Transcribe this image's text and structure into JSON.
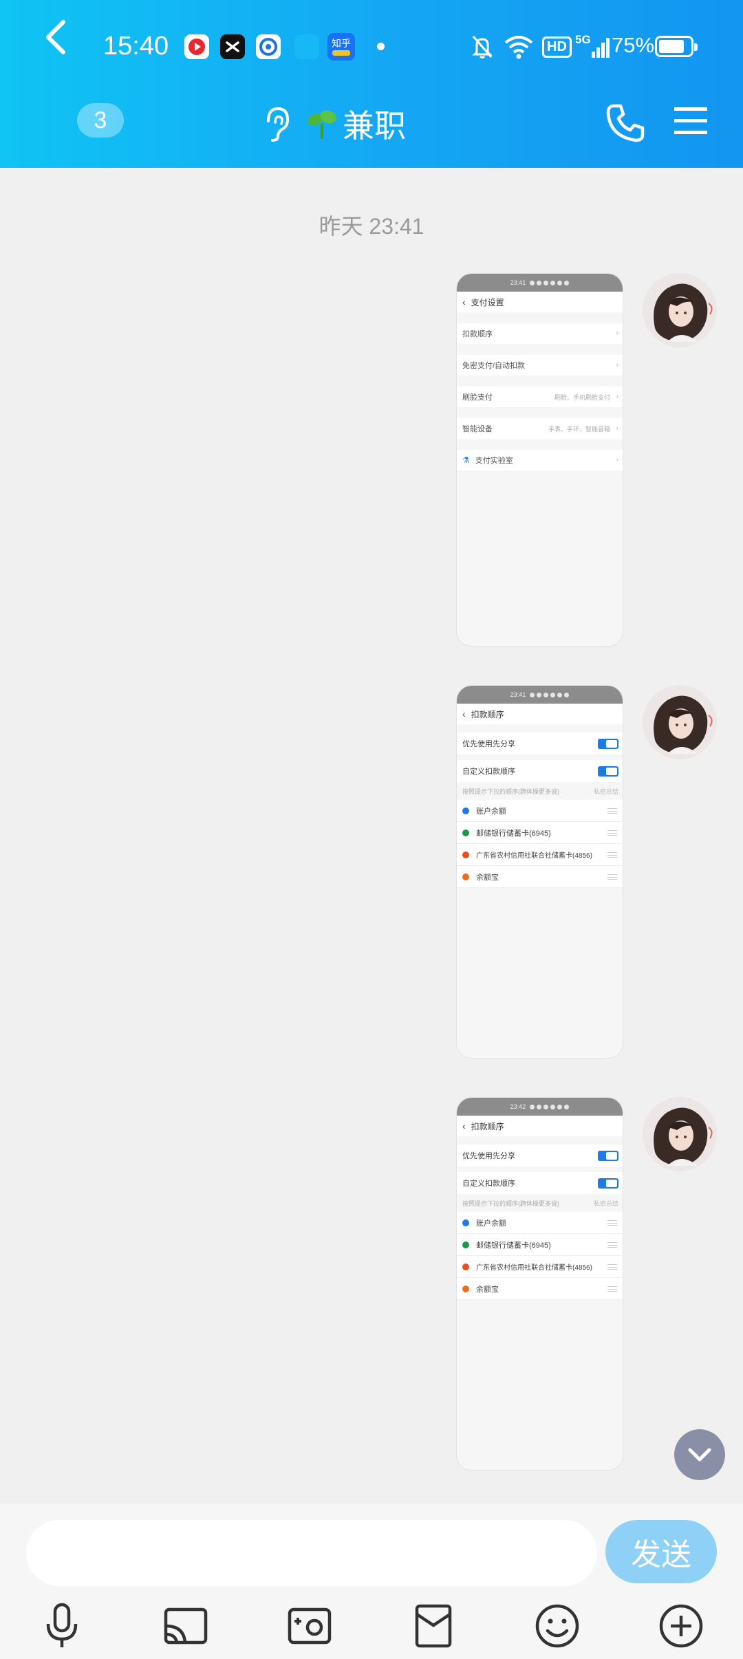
{
  "status_bar": {
    "time": "15:40",
    "app_icons": [
      "record-app-icon",
      "capcut-icon",
      "browser-app-icon",
      "zhihu-icon"
    ],
    "zhihu_label": "知乎",
    "hd_label": "HD",
    "network_label": "5G",
    "battery_percent": "75%"
  },
  "header": {
    "unread_count": "3",
    "chat_title": "兼职",
    "colors": {
      "gradient_start": "#10c4f4",
      "gradient_end": "#1296f0"
    }
  },
  "chat": {
    "timestamp": "昨天 23:41",
    "messages": [
      {
        "type": "image",
        "mini_screen": {
          "status_time": "23:41",
          "nav_title": "支付设置",
          "rows": [
            {
              "label": "扣款顺序",
              "value": ""
            },
            {
              "label": "免密支付/自动扣款",
              "value": ""
            },
            {
              "label": "刷脸支付",
              "value": "刷脸、手机刷脸支付"
            },
            {
              "label": "智能设备",
              "value": "手表、手环、智能音箱"
            },
            {
              "label": "支付实验室",
              "value": ""
            }
          ]
        }
      },
      {
        "type": "image",
        "mini_screen": {
          "status_time": "23:41",
          "nav_title": "扣款顺序",
          "toggles": [
            "优先使用先分享",
            "自定义扣款顺序"
          ],
          "hint_left": "按照提示下拉的顺序(跨体操更多说)",
          "hint_right": "私密总结",
          "payments": [
            "账户余额",
            "邮储银行储蓄卡(6945)",
            "广东省农村信用社联合社储蓄卡(4856)",
            "余额宝"
          ]
        }
      },
      {
        "type": "image",
        "mini_screen": {
          "status_time": "23:42",
          "nav_title": "扣款顺序",
          "toggles": [
            "优先使用先分享",
            "自定义扣款顺序"
          ],
          "hint_left": "按照提示下拉的顺序(跨体操更多说)",
          "hint_right": "私密总结",
          "payments": [
            "账户余额",
            "邮储银行储蓄卡(6945)",
            "广东省农村信用社联合社储蓄卡(4856)",
            "余额宝"
          ]
        }
      }
    ]
  },
  "input": {
    "placeholder": "",
    "send_label": "发送"
  },
  "toolbar": {
    "icons": [
      "microphone-icon",
      "screen-cast-icon",
      "photo-icon",
      "red-packet-icon",
      "emoji-icon",
      "plus-icon"
    ]
  }
}
